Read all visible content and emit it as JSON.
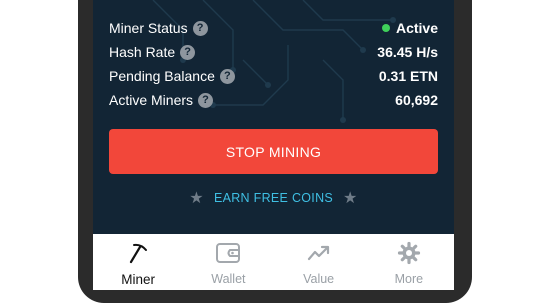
{
  "stats": [
    {
      "label": "Miner Status",
      "value": "Active",
      "status_color": "#3fd05a"
    },
    {
      "label": "Hash Rate",
      "value": "36.45 H/s"
    },
    {
      "label": "Pending Balance",
      "value": "0.31 ETN"
    },
    {
      "label": "Active Miners",
      "value": "60,692"
    }
  ],
  "help_glyph": "?",
  "stop_button": {
    "label": "STOP MINING",
    "color": "#f2473a"
  },
  "earn_link": {
    "label": "EARN FREE COINS",
    "star": "★"
  },
  "tabs": [
    {
      "label": "Miner",
      "icon": "pickaxe-icon",
      "active": true
    },
    {
      "label": "Wallet",
      "icon": "wallet-icon",
      "active": false
    },
    {
      "label": "Value",
      "icon": "trend-chart-icon",
      "active": false
    },
    {
      "label": "More",
      "icon": "gear-icon",
      "active": false
    }
  ],
  "colors": {
    "screen_bg": "#122535",
    "accent": "#3fbfe3"
  }
}
